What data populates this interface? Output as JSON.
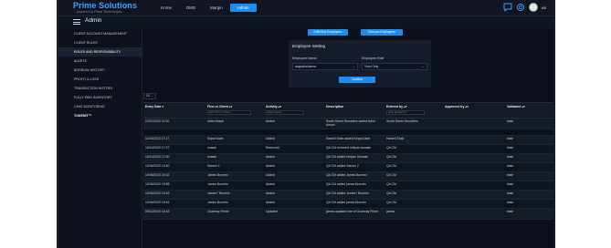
{
  "header": {
    "brand": "Prime Solutions",
    "brand_sub": "powered by Prime Technologies",
    "nav": [
      {
        "label": "Home",
        "active": false
      },
      {
        "label": "DMS",
        "active": false
      },
      {
        "label": "Margin",
        "active": false
      },
      {
        "label": "Admin",
        "active": true
      }
    ],
    "user_initials": "AB",
    "page_title": "Admin"
  },
  "sidebar": {
    "items": [
      {
        "label": "Client Account Management"
      },
      {
        "label": "Client Rules"
      },
      {
        "label": "Roles and Responsibility"
      },
      {
        "label": "Alerts"
      },
      {
        "label": "Borrow History"
      },
      {
        "label": "Profit & Loss"
      },
      {
        "label": "Transaction History"
      },
      {
        "label": "Fully Paid Inventory"
      },
      {
        "label": "Chat Monitoring"
      },
      {
        "label": "TOKENIT™"
      }
    ]
  },
  "actions": {
    "edit_view_employees": "Edit/View Employees",
    "remove_employees": "Remove Employees"
  },
  "employee_setting": {
    "title": "Employee Setting",
    "name_label": "Employee Name",
    "name_value": "aappsfssharma",
    "role_label": "Employee Role",
    "role_value": "View Only",
    "confirm_label": "Confirm"
  },
  "page_size": "10",
  "table": {
    "columns": [
      "Entry Date",
      "Firm or Client",
      "Activity",
      "Description",
      "Entered by",
      "Approved by",
      "Validated"
    ],
    "filters": [
      "Enter Firm or Client...",
      "Enter Activity...",
      "Enter Entered by..."
    ],
    "rows": [
      {
        "date": "12/07/2022 11:00",
        "firm": "Adim Ansari",
        "activity": "Added",
        "desc": "South Street Securities added Adim Ansari",
        "entered": "South Street Securities",
        "approved": "",
        "validated": "false"
      },
      {
        "date": "11/10/2022 17:17",
        "firm": "Kirpal Dave",
        "activity": "Added",
        "desc": "Harshil Shah added Kirpal Dave",
        "entered": "Harshil Shah",
        "approved": "",
        "validated": "false"
      },
      {
        "date": "10/10/2022 17:07",
        "firm": "masair",
        "activity": "Removed",
        "desc": "QA CM removed imtiyaz hussain",
        "entered": "QA CM",
        "approved": "",
        "validated": "false"
      },
      {
        "date": "10/10/2022 17:00",
        "firm": "masair",
        "activity": "Added",
        "desc": "QA CM added Imtiyaz Hussain",
        "entered": "QA CM",
        "approved": "",
        "validated": "false"
      },
      {
        "date": "10/06/2022 13:40",
        "firm": "Sairam 2",
        "activity": "Added",
        "desc": "QA CM added Sairam 2",
        "entered": "QA CM",
        "approved": "",
        "validated": "false"
      },
      {
        "date": "10/05/2022 20:02",
        "firm": "James Burnelo",
        "activity": "Added",
        "desc": "QA CM added James Burnelo",
        "entered": "QA CM",
        "approved": "",
        "validated": "false"
      },
      {
        "date": "10/05/2022 19:59",
        "firm": "James Burnelo",
        "activity": "Added",
        "desc": "QA CM added james Burnelo",
        "entered": "QA CM",
        "approved": "",
        "validated": "false"
      },
      {
        "date": "10/05/2022 19:53",
        "firm": "James7 Burnelo",
        "activity": "Added",
        "desc": "QA CM added James7 Burnelo",
        "entered": "QA CM",
        "approved": "",
        "validated": "false"
      },
      {
        "date": "10/05/2022 19:51",
        "firm": "James Burnelo",
        "activity": "Added",
        "desc": "QA CM added james Burnelo",
        "entered": "QA CM",
        "approved": "",
        "validated": "false"
      },
      {
        "date": "09/12/2022 15:43",
        "firm": "Ocamray Prime",
        "activity": "Updated",
        "desc": "james updated role of Ocamray Prime",
        "entered": "james",
        "approved": "",
        "validated": "false"
      }
    ]
  }
}
